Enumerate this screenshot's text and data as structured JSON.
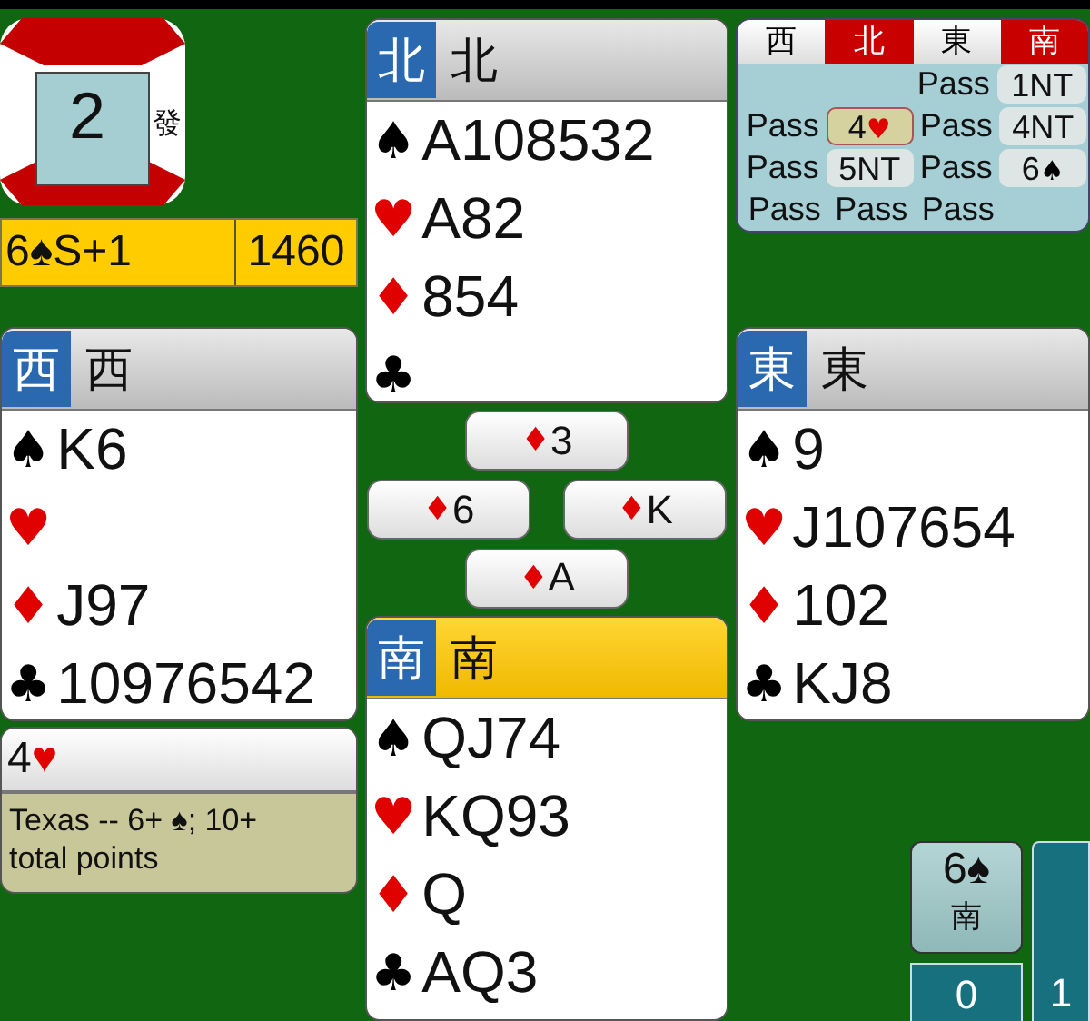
{
  "board": {
    "number": "2",
    "dealer": "發"
  },
  "contract": {
    "text": "6♠S+1",
    "score": "1460"
  },
  "north": {
    "seat": "北",
    "name": "北",
    "highlighted": false,
    "suits": [
      {
        "kind": "spades",
        "symbol": "♠",
        "cards": "A108532"
      },
      {
        "kind": "hearts",
        "symbol": "♥",
        "cards": "A82"
      },
      {
        "kind": "diamonds",
        "symbol": "♦",
        "cards": "854"
      },
      {
        "kind": "clubs",
        "symbol": "♣"
      }
    ]
  },
  "west": {
    "seat": "西",
    "name": "西",
    "highlighted": false,
    "suits": [
      {
        "kind": "spades",
        "symbol": "♠",
        "cards": "K6"
      },
      {
        "kind": "hearts",
        "symbol": "♥"
      },
      {
        "kind": "diamonds",
        "symbol": "♦",
        "cards": "J97"
      },
      {
        "kind": "clubs",
        "symbol": "♣",
        "cards": "10976542"
      }
    ]
  },
  "east": {
    "seat": "東",
    "name": "東",
    "highlighted": false,
    "suits": [
      {
        "kind": "spades",
        "symbol": "♠",
        "cards": "9"
      },
      {
        "kind": "hearts",
        "symbol": "♥",
        "cards": "J107654"
      },
      {
        "kind": "diamonds",
        "symbol": "♦",
        "cards": "102"
      },
      {
        "kind": "clubs",
        "symbol": "♣",
        "cards": "KJ8"
      }
    ]
  },
  "south": {
    "seat": "南",
    "name": "南",
    "highlighted": true,
    "suits": [
      {
        "kind": "spades",
        "symbol": "♠",
        "cards": "QJ74"
      },
      {
        "kind": "hearts",
        "symbol": "♥",
        "cards": "KQ93"
      },
      {
        "kind": "diamonds",
        "symbol": "♦",
        "cards": "Q"
      },
      {
        "kind": "clubs",
        "symbol": "♣",
        "cards": "AQ3"
      }
    ]
  },
  "auction": {
    "columns": [
      {
        "label": "西",
        "vulnerable": false
      },
      {
        "label": "北",
        "vulnerable": true
      },
      {
        "label": "東",
        "vulnerable": false
      },
      {
        "label": "南",
        "vulnerable": true
      }
    ],
    "rows": [
      [
        {
          "kind": "empty"
        },
        {
          "kind": "empty"
        },
        {
          "kind": "pass",
          "text": "Pass"
        },
        {
          "kind": "bid",
          "text": "1NT",
          "selected": false
        }
      ],
      [
        {
          "kind": "pass",
          "text": "Pass"
        },
        {
          "kind": "bid",
          "text": "4",
          "symbol": {
            "kind": "hearts",
            "text": "♥"
          },
          "selected": true
        },
        {
          "kind": "pass",
          "text": "Pass"
        },
        {
          "kind": "bid",
          "text": "4NT",
          "selected": false
        }
      ],
      [
        {
          "kind": "pass",
          "text": "Pass"
        },
        {
          "kind": "bid",
          "text": "5NT",
          "selected": false
        },
        {
          "kind": "pass",
          "text": "Pass"
        },
        {
          "kind": "bid",
          "text": "6",
          "symbol": {
            "kind": "spades",
            "text": "♠"
          },
          "selected": false
        }
      ],
      [
        {
          "kind": "pass",
          "text": "Pass"
        },
        {
          "kind": "pass",
          "text": "Pass"
        },
        {
          "kind": "pass",
          "text": "Pass"
        },
        {
          "kind": "empty"
        }
      ]
    ]
  },
  "trick": {
    "north": {
      "symbol": "♦",
      "kind": "diamonds",
      "rank": "3"
    },
    "west": {
      "symbol": "♦",
      "kind": "diamonds",
      "rank": "6"
    },
    "east": {
      "symbol": "♦",
      "kind": "diamonds",
      "rank": "K"
    },
    "south": {
      "symbol": "♦",
      "kind": "diamonds",
      "rank": "A"
    }
  },
  "explanation": {
    "bid": "4",
    "symbol": {
      "kind": "hearts",
      "text": "♥"
    },
    "text": "Texas -- 6+ ♠; 10+ total points"
  },
  "final_contract": {
    "bid": "6♠",
    "declarer": "南"
  },
  "tricks_won": [
    {
      "value": "0"
    },
    {
      "value": "1"
    }
  ]
}
